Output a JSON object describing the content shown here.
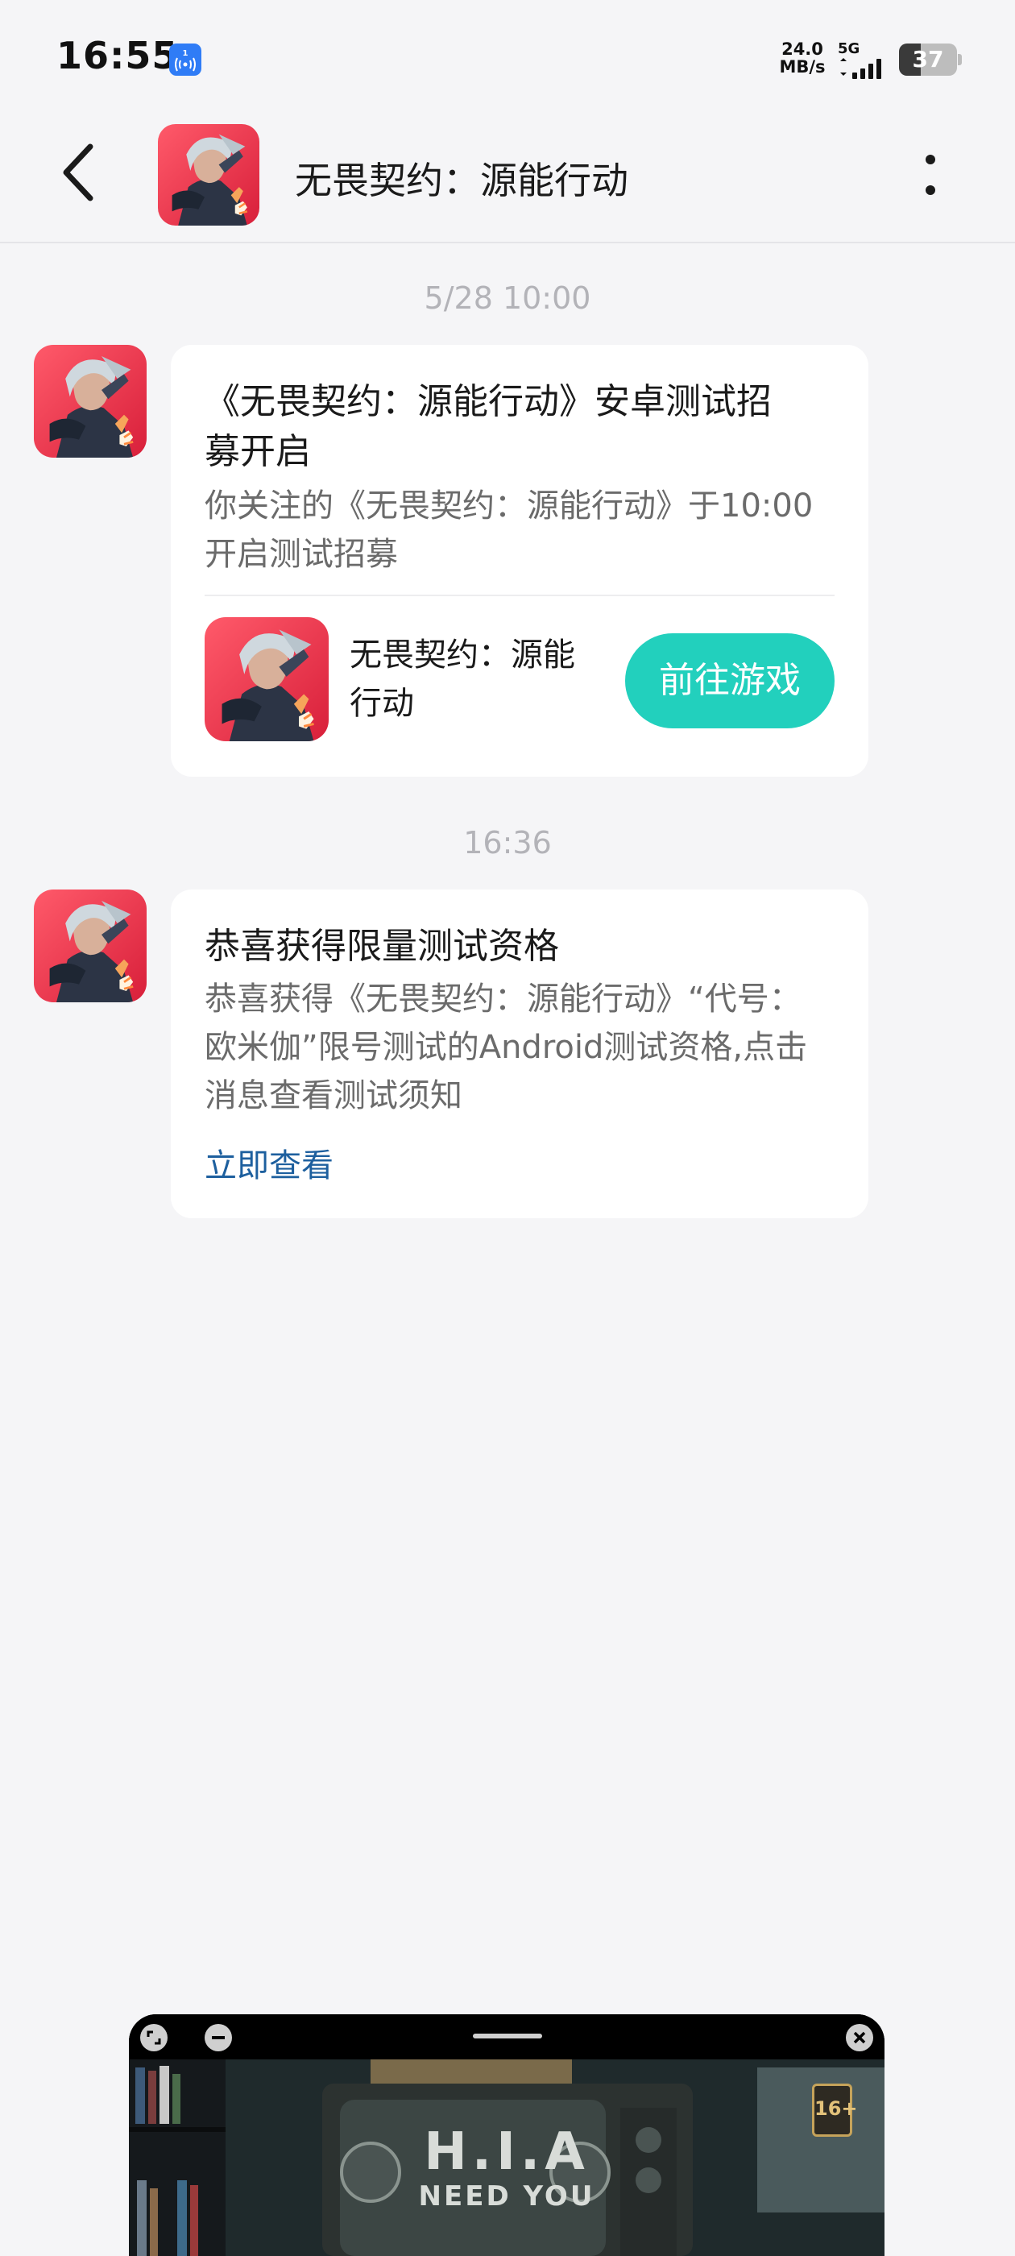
{
  "status_bar": {
    "time": "16:55",
    "net_speed_value": "24.0",
    "net_speed_unit": "MB/s",
    "network_type": "5G",
    "battery_level": "37"
  },
  "header": {
    "title": "无畏契约：源能行动"
  },
  "messages": [
    {
      "timestamp": "5/28  10:00",
      "title_line1": "《无畏契约：源能行动》安卓测试招",
      "title_line2": "募开启",
      "body_line1": "你关注的《无畏契约：源能行动》于10:00",
      "body_line2": "开启测试招募",
      "game_name_line1": "无畏契约：源能",
      "game_name_line2": "行动",
      "button_label": "前往游戏"
    },
    {
      "timestamp": "16:36",
      "title": "恭喜获得限量测试资格",
      "body_line1": "恭喜获得《无畏契约：源能行动》“代号：",
      "body_line2": "欧米伽”限号测试的Android测试资格,点击",
      "body_line3": "消息查看测试须知",
      "link_label": "立即查看"
    }
  ],
  "floating_window": {
    "rating": "16+",
    "tv_line1": "H.I.A",
    "tv_line2": "NEED YOU"
  },
  "colors": {
    "accent_button": "#22d0bd",
    "link": "#1d5f9e",
    "background": "#f5f5f7"
  }
}
